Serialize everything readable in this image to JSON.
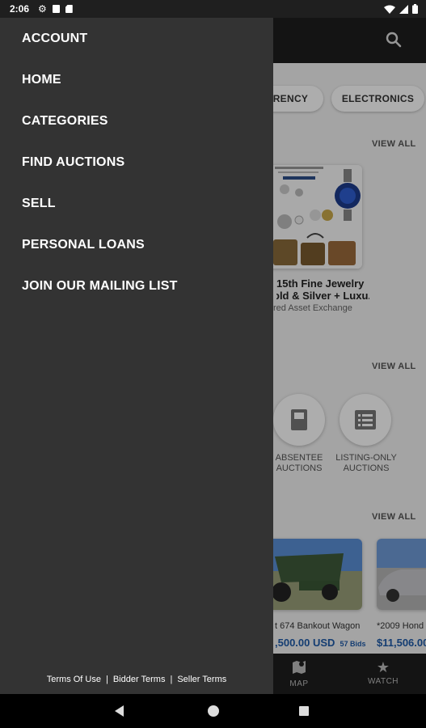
{
  "status_bar": {
    "time": "2:06",
    "left_icons": [
      "gear-icon",
      "notification-square-icon",
      "sd-card-icon"
    ],
    "right_icons": [
      "wifi-icon",
      "signal-icon",
      "battery-icon"
    ]
  },
  "drawer": {
    "menu": [
      {
        "label": "ACCOUNT"
      },
      {
        "label": "HOME"
      },
      {
        "label": "CATEGORIES"
      },
      {
        "label": "FIND AUCTIONS"
      },
      {
        "label": "SELL"
      },
      {
        "label": "PERSONAL LOANS"
      },
      {
        "label": "JOIN OUR MAILING LIST"
      }
    ],
    "footer": {
      "terms_of_use": "Terms Of Use",
      "separator": "|",
      "bidder_terms": "Bidder Terms",
      "seller_terms": "Seller Terms"
    }
  },
  "background_app": {
    "chips": [
      "RRENCY",
      "ELECTRONICS"
    ],
    "view_all": "VIEW ALL",
    "featured": {
      "title_line1": "15th Fine Jewelry",
      "title_line2": "old & Silver + Luxu...",
      "subtitle": "red Asset Exchange"
    },
    "auction_types": [
      {
        "line1": "ABSENTEE",
        "line2": "AUCTIONS"
      },
      {
        "line1": "LISTING-ONLY",
        "line2": "AUCTIONS"
      }
    ],
    "auctions": [
      {
        "title": "t 674 Bankout Wagon",
        "price": ",500.00 USD",
        "bids": "57 Bids"
      },
      {
        "title": "*2009 Hond",
        "price": "$11,506.00",
        "bids": ""
      }
    ],
    "bottom_nav": [
      {
        "label": "MAP",
        "icon": "map-icon"
      },
      {
        "label": "WATCH",
        "icon": "star-icon"
      }
    ]
  },
  "system_nav": {
    "buttons": [
      "back-icon",
      "home-icon",
      "recent-apps-icon"
    ]
  },
  "colors": {
    "drawer_bg": "#333333",
    "header_bg": "#1e1e1e",
    "price_blue": "#1e5aa8"
  }
}
